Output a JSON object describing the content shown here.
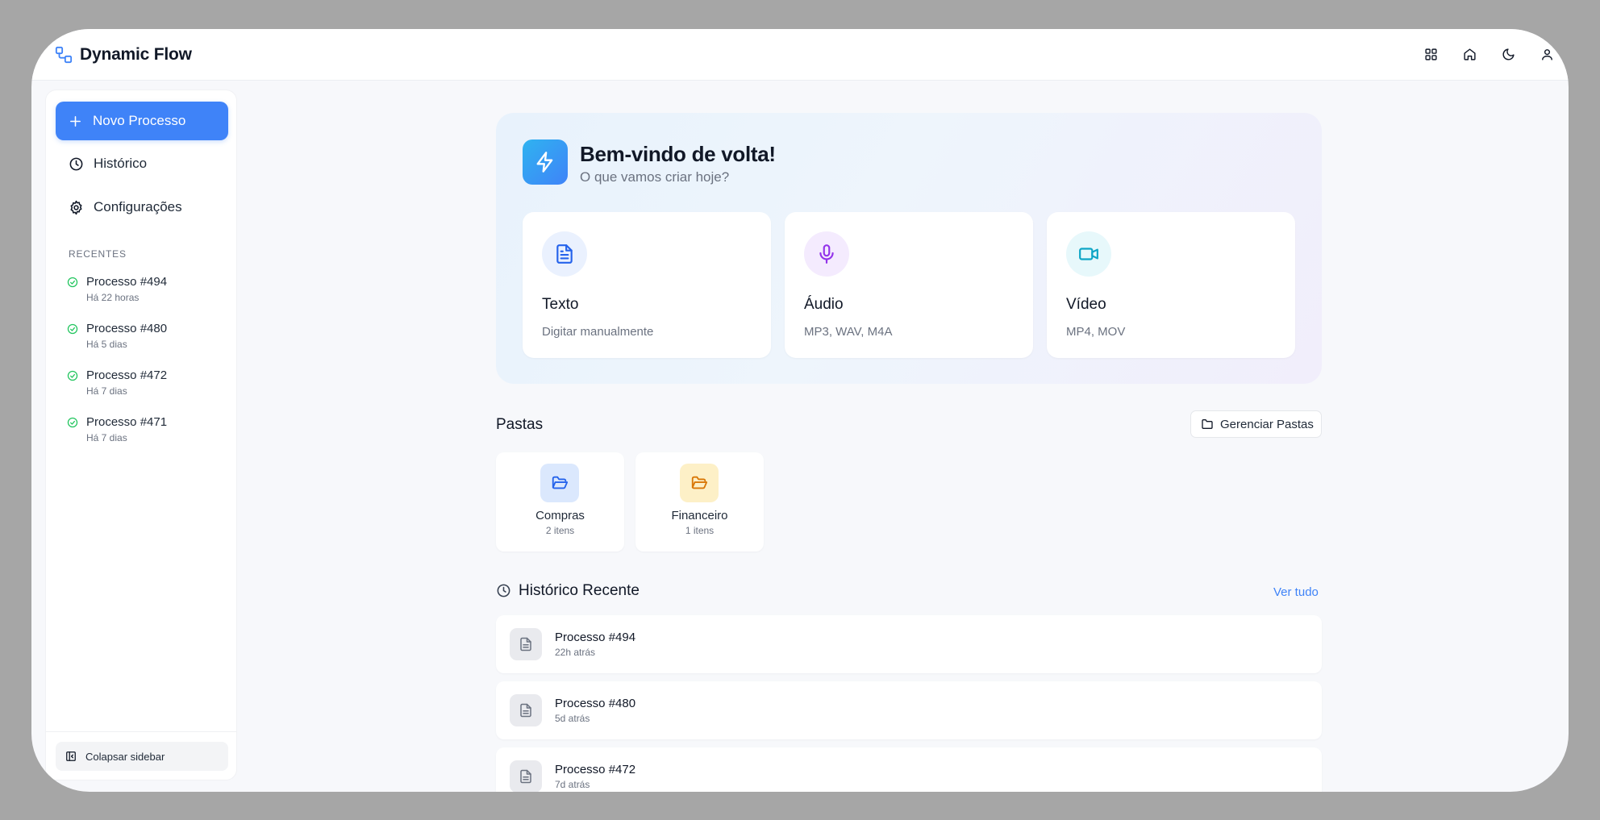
{
  "app": {
    "title": "Dynamic Flow"
  },
  "topbar": {
    "icons": [
      "grid-icon",
      "home-icon",
      "moon-icon",
      "user-icon"
    ]
  },
  "sidebar": {
    "new_button": "Novo Processo",
    "nav": [
      {
        "label": "Histórico",
        "icon": "clock-icon"
      },
      {
        "label": "Configurações",
        "icon": "gear-icon"
      }
    ],
    "recent_label": "RECENTES",
    "recent": [
      {
        "name": "Processo #494",
        "time": "Há 22 horas"
      },
      {
        "name": "Processo #480",
        "time": "Há 5 dias"
      },
      {
        "name": "Processo #472",
        "time": "Há 7 dias"
      },
      {
        "name": "Processo #471",
        "time": "Há 7 dias"
      }
    ],
    "collapse": "Colapsar sidebar"
  },
  "hero": {
    "title": "Bem-vindo de volta!",
    "subtitle": "O que vamos criar hoje?",
    "cards": [
      {
        "title": "Texto",
        "subtitle": "Digitar manualmente",
        "icon": "document-icon",
        "color": "#2563eb",
        "bg": "#eaf1fe"
      },
      {
        "title": "Áudio",
        "subtitle": "MP3, WAV, M4A",
        "icon": "microphone-icon",
        "color": "#9333ea",
        "bg": "#f4ebfe"
      },
      {
        "title": "Vídeo",
        "subtitle": "MP4, MOV",
        "icon": "video-icon",
        "color": "#0ea5c6",
        "bg": "#e7f8fb"
      }
    ]
  },
  "folders": {
    "title": "Pastas",
    "manage_button": "Gerenciar Pastas",
    "items": [
      {
        "name": "Compras",
        "count": "2 itens",
        "color": "#2563eb",
        "bg": "#dbe8fd"
      },
      {
        "name": "Financeiro",
        "count": "1 itens",
        "color": "#d97706",
        "bg": "#fdf0c7"
      }
    ]
  },
  "history": {
    "title": "Histórico Recente",
    "see_all": "Ver tudo",
    "items": [
      {
        "name": "Processo #494",
        "time": "22h atrás"
      },
      {
        "name": "Processo #480",
        "time": "5d atrás"
      },
      {
        "name": "Processo #472",
        "time": "7d atrás"
      }
    ]
  },
  "colors": {
    "accent": "#3f83f8",
    "success": "#22c55e"
  }
}
